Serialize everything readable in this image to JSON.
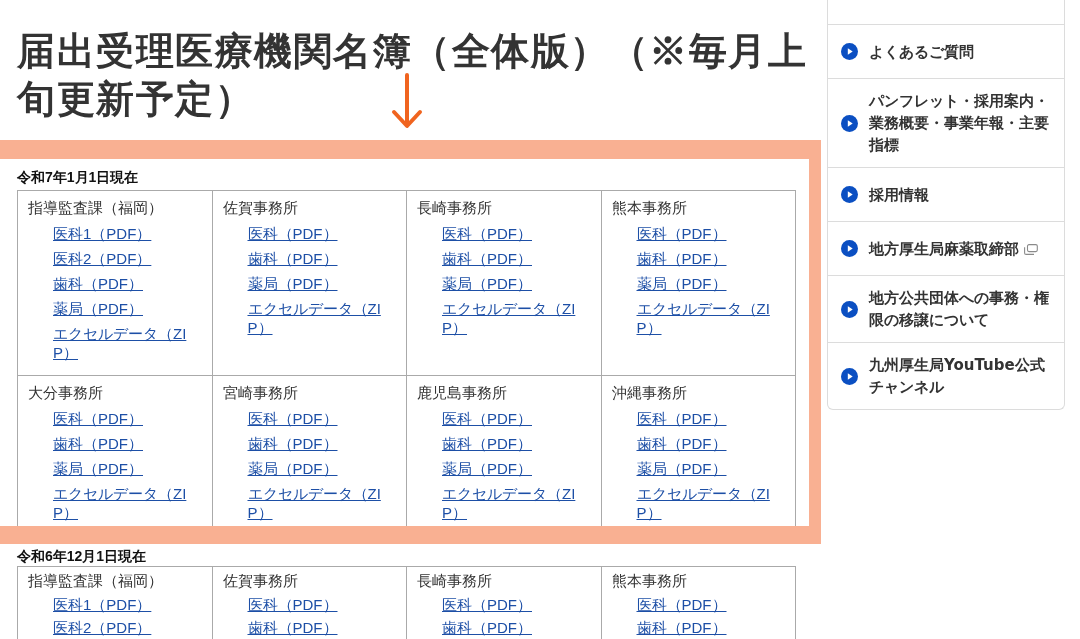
{
  "page_title": "届出受理医療機関名簿（全体版）（※毎月上旬更新予定）",
  "sections": [
    {
      "heading": "令和7年1月1日現在",
      "rows": [
        [
          {
            "office": "指導監査課（福岡）",
            "links": [
              "医科1（PDF）",
              "医科2（PDF）",
              "歯科（PDF）",
              "薬局（PDF）",
              "エクセルデータ（ZIP）"
            ]
          },
          {
            "office": "佐賀事務所",
            "links": [
              "医科（PDF）",
              "歯科（PDF）",
              "薬局（PDF）",
              "エクセルデータ（ZIP）"
            ]
          },
          {
            "office": "長崎事務所",
            "links": [
              "医科（PDF）",
              "歯科（PDF）",
              "薬局（PDF）",
              "エクセルデータ（ZIP）"
            ]
          },
          {
            "office": "熊本事務所",
            "links": [
              "医科（PDF）",
              "歯科（PDF）",
              "薬局（PDF）",
              "エクセルデータ（ZIP）"
            ]
          }
        ],
        [
          {
            "office": "大分事務所",
            "links": [
              "医科（PDF）",
              "歯科（PDF）",
              "薬局（PDF）",
              "エクセルデータ（ZIP）"
            ]
          },
          {
            "office": "宮崎事務所",
            "links": [
              "医科（PDF）",
              "歯科（PDF）",
              "薬局（PDF）",
              "エクセルデータ（ZIP）"
            ]
          },
          {
            "office": "鹿児島事務所",
            "links": [
              "医科（PDF）",
              "歯科（PDF）",
              "薬局（PDF）",
              "エクセルデータ（ZIP）"
            ]
          },
          {
            "office": "沖縄事務所",
            "links": [
              "医科（PDF）",
              "歯科（PDF）",
              "薬局（PDF）",
              "エクセルデータ（ZIP）"
            ]
          }
        ]
      ]
    },
    {
      "heading": "令和6年12月1日現在",
      "rows": [
        [
          {
            "office": "指導監査課（福岡）",
            "links": [
              "医科1（PDF）",
              "医科2（PDF）"
            ]
          },
          {
            "office": "佐賀事務所",
            "links": [
              "医科（PDF）",
              "歯科（PDF）"
            ]
          },
          {
            "office": "長崎事務所",
            "links": [
              "医科（PDF）",
              "歯科（PDF）"
            ]
          },
          {
            "office": "熊本事務所",
            "links": [
              "医科（PDF）",
              "歯科（PDF）"
            ]
          }
        ]
      ]
    }
  ],
  "sidebar": {
    "items": [
      {
        "label": "よくあるご質問",
        "external": false
      },
      {
        "label": "パンフレット・採用案内・業務概要・事業年報・主要指標",
        "external": false
      },
      {
        "label": "採用情報",
        "external": false
      },
      {
        "label": "地方厚生局麻薬取締部",
        "external": true
      },
      {
        "label": "地方公共団体への事務・権限の移譲について",
        "external": false
      },
      {
        "label": "九州厚生局YouTube公式チャンネル",
        "external": false
      }
    ]
  },
  "annotations": {
    "arrow": true,
    "highlight_frame": true
  }
}
